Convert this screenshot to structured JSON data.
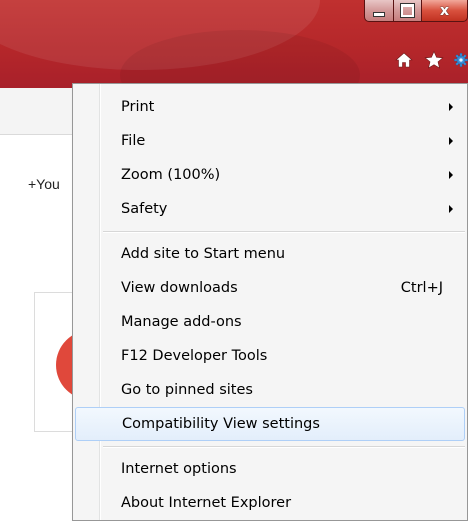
{
  "window": {
    "controls": {
      "minimize_icon": "minimize-icon",
      "maximize_icon": "restore-icon",
      "close_icon": "close-icon",
      "close_glyph": "x"
    },
    "toolbar_icons": [
      "home-icon",
      "favorites-star-icon",
      "tools-gear-icon"
    ]
  },
  "page": {
    "visible_text": "+You"
  },
  "menu": {
    "items_group1": [
      {
        "label": "Print",
        "submenu": true
      },
      {
        "label": "File",
        "submenu": true
      },
      {
        "label": "Zoom (100%)",
        "submenu": true
      },
      {
        "label": "Safety",
        "submenu": true
      }
    ],
    "items_group2": [
      {
        "label": "Add site to Start menu"
      },
      {
        "label": "View downloads",
        "shortcut": "Ctrl+J"
      },
      {
        "label": "Manage add-ons"
      },
      {
        "label": "F12 Developer Tools"
      },
      {
        "label": "Go to pinned sites"
      },
      {
        "label": "Compatibility View settings",
        "highlighted": true
      }
    ],
    "items_group3": [
      {
        "label": "Internet options"
      },
      {
        "label": "About Internet Explorer"
      }
    ]
  },
  "colors": {
    "titlebar": "#b5272a",
    "menu_bg": "#f5f5f5",
    "highlight_border": "#aecff7",
    "gear_blue": "#3b8fd8"
  }
}
